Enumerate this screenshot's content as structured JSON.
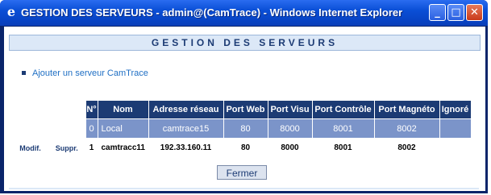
{
  "window": {
    "title": "GESTION DES SERVEURS - admin@(CamTrace) - Windows Internet Explorer",
    "minimize_glyph": "_",
    "maximize_glyph": "□",
    "close_glyph": "✕"
  },
  "page": {
    "header": "GESTION DES SERVEURS",
    "add_link": "Ajouter un serveur CamTrace",
    "close_button": "Fermer"
  },
  "table": {
    "columns": [
      "N°",
      "Nom",
      "Adresse réseau",
      "Port Web",
      "Port Visu",
      "Port Contrôle",
      "Port Magnéto",
      "Ignoré"
    ],
    "rows": [
      {
        "modif": "",
        "suppr": "",
        "num": "0",
        "nom": "Local",
        "adresse": "camtrace15",
        "port_web": "80",
        "port_visu": "8000",
        "port_controle": "8001",
        "port_magneto": "8002",
        "ignore": ""
      },
      {
        "modif": "Modif.",
        "suppr": "Suppr.",
        "num": "1",
        "nom": "camtracc11",
        "adresse": "192.33.160.11",
        "port_web": "80",
        "port_visu": "8000",
        "port_controle": "8001",
        "port_magneto": "8002",
        "ignore": ""
      }
    ]
  },
  "colors": {
    "header_bg": "#1c3b74",
    "row_highlight": "#7b94c9",
    "link": "#1f6fc4"
  }
}
